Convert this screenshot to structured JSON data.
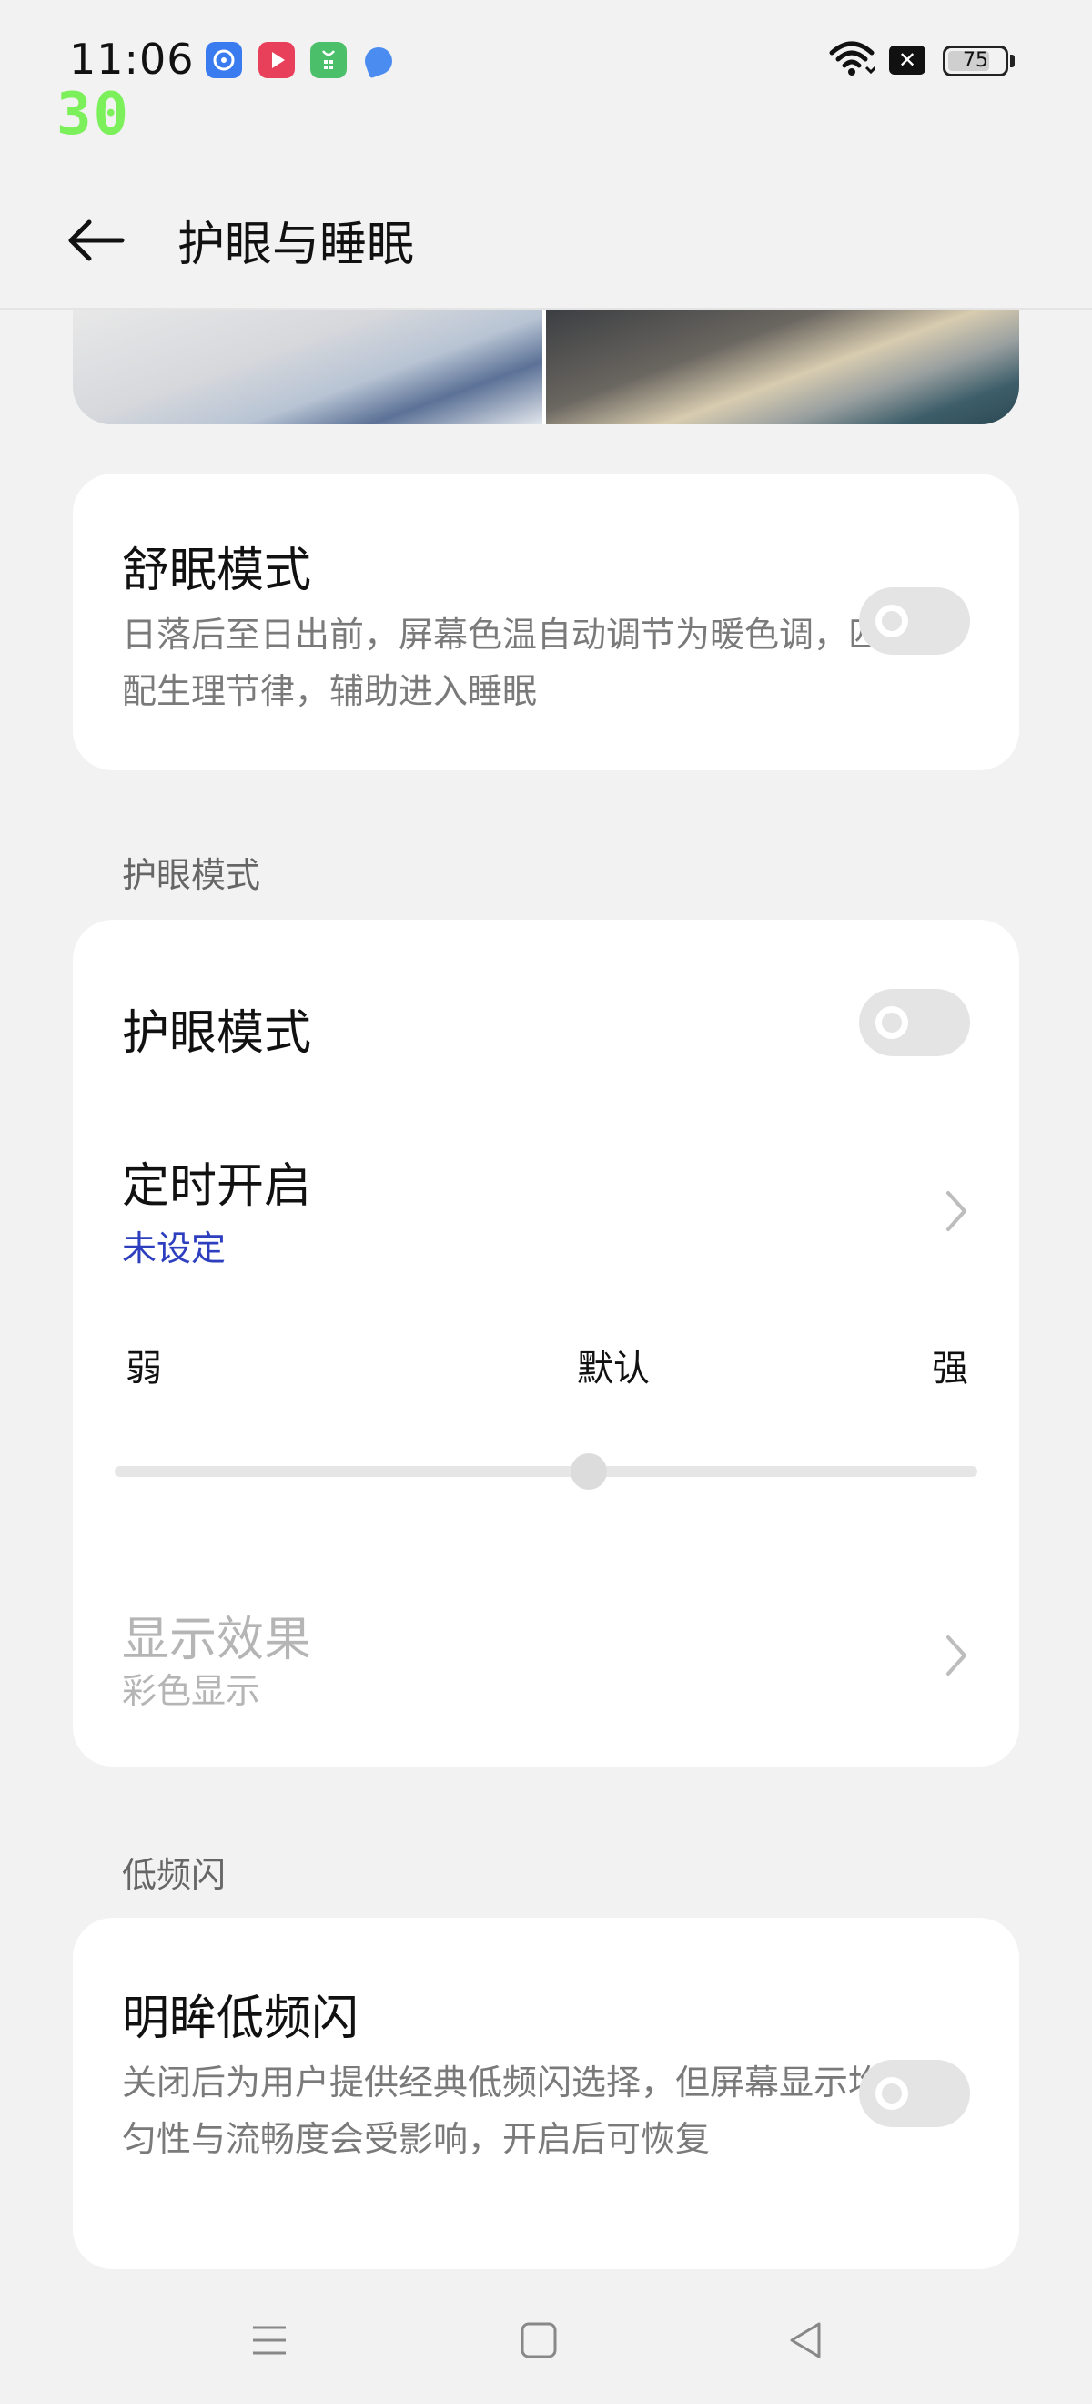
{
  "status_bar": {
    "time": "11:06",
    "app_icons": [
      "chat-bubble-icon",
      "play-icon",
      "shopping-bag-icon",
      "feather-icon"
    ],
    "battery": "75",
    "battery_level": 0.75,
    "fps_overlay": "30"
  },
  "header": {
    "title": "护眼与睡眠"
  },
  "sleep_card": {
    "title": "舒眠模式",
    "description": "日落后至日出前，屏幕色温自动调节为暖色调，匹配生理节律，辅助进入睡眠",
    "enabled": false
  },
  "eye_section": {
    "label": "护眼模式",
    "toggle_row": {
      "title": "护眼模式",
      "enabled": false
    },
    "schedule_row": {
      "title": "定时开启",
      "value": "未设定"
    },
    "intensity": {
      "min_label": "弱",
      "mid_label": "默认",
      "max_label": "强",
      "value": 0.55
    },
    "display_effect_row": {
      "title": "显示效果",
      "value": "彩色显示",
      "disabled": true
    }
  },
  "flicker_section": {
    "label": "低频闪",
    "row": {
      "title": "明眸低频闪",
      "description": "关闭后为用户提供经典低频闪选择，但屏幕显示均匀性与流畅度会受影响，开启后可恢复",
      "enabled": false
    }
  },
  "nav_bar": {
    "buttons": [
      "menu-icon",
      "home-icon",
      "back-triangle-icon"
    ]
  },
  "colors": {
    "accent_blue": "#2d3fbf",
    "background": "#f2f2f2",
    "card": "#ffffff",
    "fps_green": "#7cf05a"
  }
}
